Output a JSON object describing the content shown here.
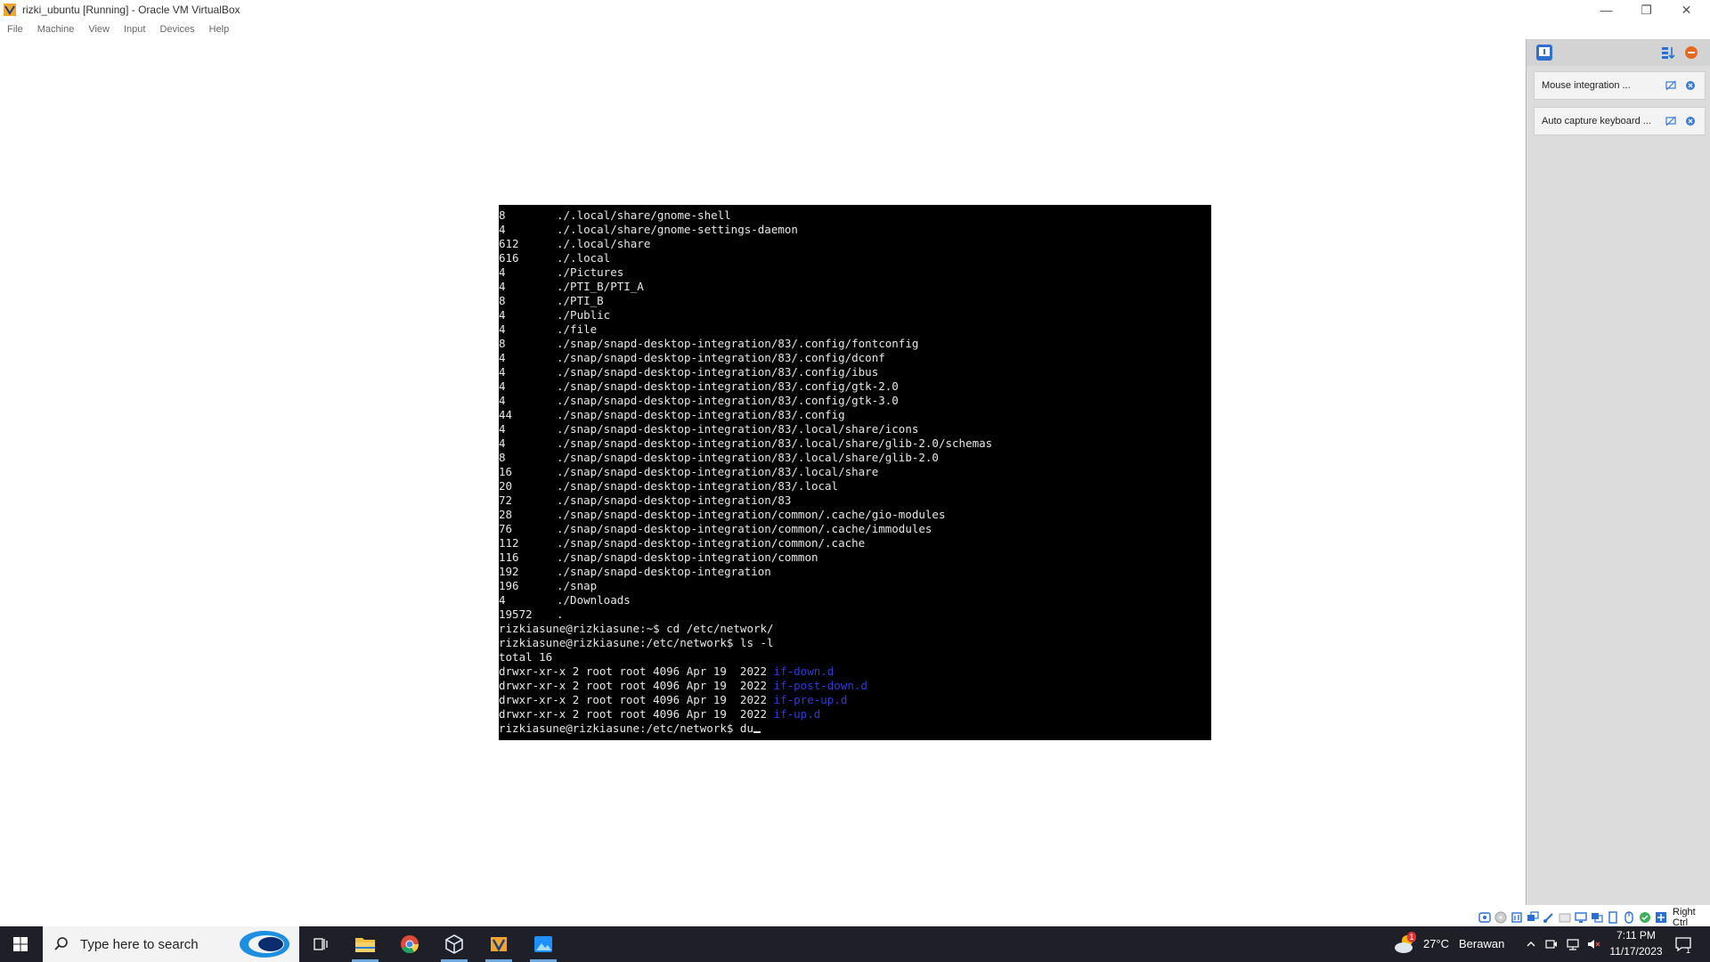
{
  "window": {
    "title": "rizki_ubuntu [Running] - Oracle VM VirtualBox",
    "controls": {
      "minimize": "—",
      "restore": "❐",
      "close": "✕"
    }
  },
  "menu": [
    "File",
    "Machine",
    "View",
    "Input",
    "Devices",
    "Help"
  ],
  "terminal": {
    "lines": [
      {
        "size": "8",
        "path": "./.local/share/gnome-shell"
      },
      {
        "size": "4",
        "path": "./.local/share/gnome-settings-daemon"
      },
      {
        "size": "612",
        "path": "./.local/share"
      },
      {
        "size": "616",
        "path": "./.local"
      },
      {
        "size": "4",
        "path": "./Pictures"
      },
      {
        "size": "4",
        "path": "./PTI_B/PTI_A"
      },
      {
        "size": "8",
        "path": "./PTI_B"
      },
      {
        "size": "4",
        "path": "./Public"
      },
      {
        "size": "4",
        "path": "./file"
      },
      {
        "size": "8",
        "path": "./snap/snapd-desktop-integration/83/.config/fontconfig"
      },
      {
        "size": "4",
        "path": "./snap/snapd-desktop-integration/83/.config/dconf"
      },
      {
        "size": "4",
        "path": "./snap/snapd-desktop-integration/83/.config/ibus"
      },
      {
        "size": "4",
        "path": "./snap/snapd-desktop-integration/83/.config/gtk-2.0"
      },
      {
        "size": "4",
        "path": "./snap/snapd-desktop-integration/83/.config/gtk-3.0"
      },
      {
        "size": "44",
        "path": "./snap/snapd-desktop-integration/83/.config"
      },
      {
        "size": "4",
        "path": "./snap/snapd-desktop-integration/83/.local/share/icons"
      },
      {
        "size": "4",
        "path": "./snap/snapd-desktop-integration/83/.local/share/glib-2.0/schemas"
      },
      {
        "size": "8",
        "path": "./snap/snapd-desktop-integration/83/.local/share/glib-2.0"
      },
      {
        "size": "16",
        "path": "./snap/snapd-desktop-integration/83/.local/share"
      },
      {
        "size": "20",
        "path": "./snap/snapd-desktop-integration/83/.local"
      },
      {
        "size": "72",
        "path": "./snap/snapd-desktop-integration/83"
      },
      {
        "size": "28",
        "path": "./snap/snapd-desktop-integration/common/.cache/gio-modules"
      },
      {
        "size": "76",
        "path": "./snap/snapd-desktop-integration/common/.cache/immodules"
      },
      {
        "size": "112",
        "path": "./snap/snapd-desktop-integration/common/.cache"
      },
      {
        "size": "116",
        "path": "./snap/snapd-desktop-integration/common"
      },
      {
        "size": "192",
        "path": "./snap/snapd-desktop-integration"
      },
      {
        "size": "196",
        "path": "./snap"
      },
      {
        "size": "4",
        "path": "./Downloads"
      },
      {
        "size": "19572",
        "path": "."
      }
    ],
    "cmd1": "rizkiasune@rizkiasune:~$ cd /etc/network/",
    "cmd2": "rizkiasune@rizkiasune:/etc/network$ ls -l",
    "total": "total 16",
    "ls_rows": [
      {
        "meta": "drwxr-xr-x 2 root root 4096 Apr 19  2022 ",
        "name": "if-down.d"
      },
      {
        "meta": "drwxr-xr-x 2 root root 4096 Apr 19  2022 ",
        "name": "if-post-down.d"
      },
      {
        "meta": "drwxr-xr-x 2 root root 4096 Apr 19  2022 ",
        "name": "if-pre-up.d"
      },
      {
        "meta": "drwxr-xr-x 2 root root 4096 Apr 19  2022 ",
        "name": "if-up.d"
      }
    ],
    "prompt": "rizkiasune@rizkiasune:/etc/network$ du"
  },
  "notifications": [
    {
      "text": "Mouse integration ..."
    },
    {
      "text": "Auto capture keyboard ..."
    }
  ],
  "statusbar": {
    "hostkey": "Right Ctrl"
  },
  "taskbar": {
    "search_placeholder": "Type here to search",
    "weather_temp": "27°C",
    "weather_desc": "Berawan",
    "weather_badge": "1",
    "time": "7:11 PM",
    "date": "11/17/2023",
    "notif_count": "1"
  },
  "colors": {
    "terminal_bg": "#000000",
    "terminal_fg": "#e8e8e8",
    "dir_blue": "#2f3bd6",
    "taskbar_bg": "#1f1f27"
  }
}
